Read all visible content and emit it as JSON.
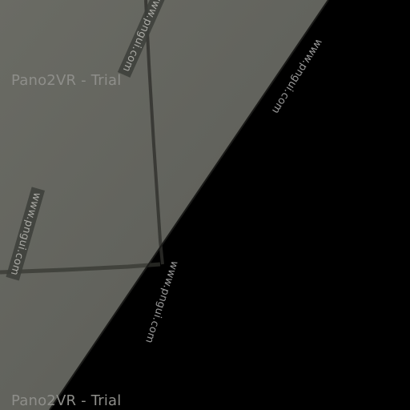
{
  "viewer": {
    "trial_label_top": "Pano2VR - Trial",
    "trial_label_bottom": "Pano2VR - Trial",
    "watermark_text": "www.pngui.com"
  },
  "colors": {
    "wall": "#6b6c65",
    "background": "#000000",
    "crack": "#2c2d29"
  }
}
